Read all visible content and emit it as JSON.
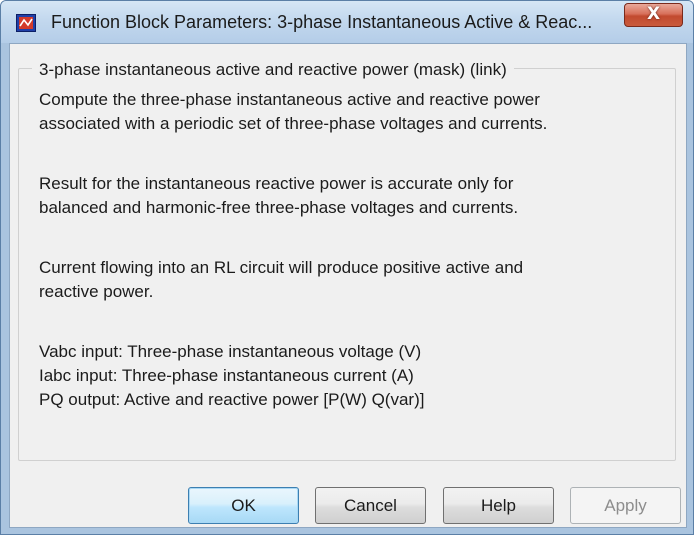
{
  "window": {
    "title": "Function Block Parameters: 3-phase Instantaneous Active & Reac...",
    "close_label": "X"
  },
  "group": {
    "legend": "3-phase instantaneous active and reactive power (mask) (link)"
  },
  "description": {
    "lines": [
      "Compute the three-phase instantaneous active and reactive power",
      "associated with a periodic set of three-phase voltages and currents.",
      "Result for the instantaneous reactive power is accurate only for",
      "balanced and harmonic-free three-phase voltages and currents.",
      "Current flowing into an RL circuit will produce  positive active and",
      "reactive power.",
      "Vabc input: Three-phase instantaneous voltage (V)",
      "Iabc input: Three-phase instantaneous current (A)",
      "PQ output: Active and reactive power [P(W) Q(var)]"
    ]
  },
  "buttons": {
    "ok": "OK",
    "cancel": "Cancel",
    "help": "Help",
    "apply": "Apply"
  },
  "icons": {
    "title_icon": "simulink-block-icon",
    "close_icon": "close-icon"
  }
}
